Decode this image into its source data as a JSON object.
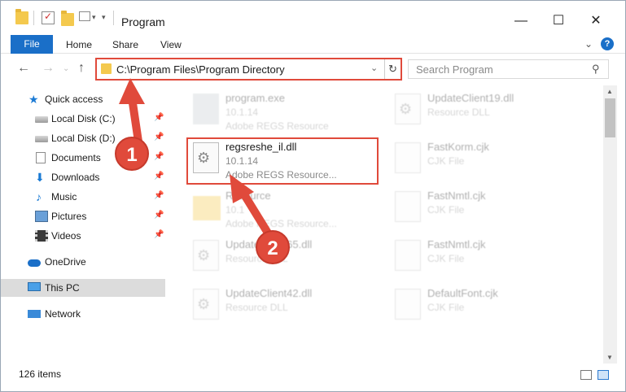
{
  "window": {
    "title": "Program"
  },
  "ribbon": {
    "file": "File",
    "home": "Home",
    "share": "Share",
    "view": "View",
    "help": "?"
  },
  "address": {
    "path": "C:\\Program Files\\Program Directory",
    "search_placeholder": "Search Program"
  },
  "sidebar": {
    "items": [
      {
        "label": "Quick access",
        "icon": "star-icon"
      },
      {
        "label": "Local Disk (C:)",
        "icon": "disk-icon",
        "pinned": true
      },
      {
        "label": "Local Disk (D:)",
        "icon": "disk-icon",
        "pinned": true
      },
      {
        "label": "Documents",
        "icon": "documents-icon",
        "pinned": true
      },
      {
        "label": "Downloads",
        "icon": "download-icon",
        "pinned": true
      },
      {
        "label": "Music",
        "icon": "music-icon",
        "pinned": true
      },
      {
        "label": "Pictures",
        "icon": "pictures-icon",
        "pinned": true
      },
      {
        "label": "Videos",
        "icon": "videos-icon",
        "pinned": true
      },
      {
        "label": "OneDrive",
        "icon": "cloud-icon"
      },
      {
        "label": "This PC",
        "icon": "pc-icon",
        "selected": true
      },
      {
        "label": "Network",
        "icon": "network-icon"
      }
    ]
  },
  "files": [
    {
      "name": "program.exe",
      "line2": "10.1.14",
      "line3": "Adobe REGS Resource",
      "icon": "app-icon",
      "highlighted": false
    },
    {
      "name": "regsreshe_il.dll",
      "line2": "10.1.14",
      "line3": "Adobe REGS Resource...",
      "icon": "gear-file-icon",
      "highlighted": true
    },
    {
      "name": "Resource",
      "line2": "10.1",
      "line3": "Adobe REGS Resource...",
      "icon": "folder-icon",
      "highlighted": false
    },
    {
      "name": "UpdateClient65.dll",
      "line2": "Resource DLL",
      "line3": "",
      "icon": "gear-file-icon",
      "highlighted": false
    },
    {
      "name": "UpdateClient42.dll",
      "line2": "Resource DLL",
      "line3": "",
      "icon": "gear-file-icon",
      "highlighted": false
    },
    {
      "name": "UpdateClient19.dll",
      "line2": "Resource DLL",
      "line3": "",
      "icon": "gear-file-icon",
      "highlighted": false
    },
    {
      "name": "FastKorm.cjk",
      "line2": "CJK File",
      "line3": "",
      "icon": "blank-file-icon",
      "highlighted": false
    },
    {
      "name": "FastNmtl.cjk",
      "line2": "CJK File",
      "line3": "",
      "icon": "blank-file-icon",
      "highlighted": false
    },
    {
      "name": "FastNmtl.cjk",
      "line2": "CJK File",
      "line3": "",
      "icon": "blank-file-icon",
      "highlighted": false
    },
    {
      "name": "DefaultFont.cjk",
      "line2": "CJK File",
      "line3": "",
      "icon": "blank-file-icon",
      "highlighted": false
    }
  ],
  "status": {
    "items": "126 items"
  },
  "callouts": {
    "one": "1",
    "two": "2"
  },
  "colors": {
    "accent": "#1a6fc8",
    "highlight": "#e04a3b",
    "selected": "#dcdcdc"
  }
}
